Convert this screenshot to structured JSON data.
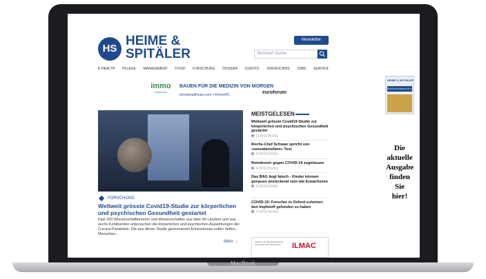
{
  "site": {
    "logo_mark": "HS",
    "logo_line1": "HEIME &",
    "logo_line2": "SPITÄLER",
    "newsletter_label": "Newsletter",
    "search_placeholder": "Stichwort Suche",
    "nav": [
      "E-HEALTH",
      "PFLEGE",
      "MANAGEMENT",
      "FOOD",
      "FORSCHUNG",
      "DOSSIER",
      "EVENTS",
      "VERZEICHNIS",
      "JOBS",
      "SERVICE"
    ]
  },
  "banner_ad": {
    "brand": "immo",
    "brand_sub": "healthcare",
    "headline": "BAUEN FÜR DIE MEDIZIN VON MORGEN",
    "url": "immohealthcare.com | #ImmoHC",
    "partner": "euroforum"
  },
  "main_article": {
    "category": "FORSCHUNG",
    "title": "Weltweit grösste Covid19-Studie zur körperlichen und psychischen Gesundheit gestartet",
    "excerpt": "Fast 200 Wissenschaftlerinnen und Wissenschaftler aus über 40 Ländern und aus sechs Kontinenten untersuchen die körperlichen und psychischen Auswirkungen der Corona-Pandemie. Die aus dieser Studie gewonnenen Erkenntnisse sollen helfen, Menschen...",
    "more_label": "Mehr →"
  },
  "meistgelesen": {
    "title": "MEISTGELESEN",
    "items": [
      {
        "title": "Weltweit grösste Covid19-Studie zur körperlichen und psychischen Gesundheit gestartet",
        "category": "FORSCHUNG"
      },
      {
        "title": "Roche-Chef Schwan spricht von «sensationellem» Test",
        "category": "FORSCHUNG"
      },
      {
        "title": "Remdesivir gegen COVID-19 zugelassen",
        "category": "FORSCHUNG"
      },
      {
        "title": "Das BAG liegt falsch - Kinder können genauso ansteckend sein wie Erwachsene",
        "category": "FORSCHUNG"
      },
      {
        "title": "COVID-19: Forscher in Oxford scheinen den Impfstoff gefunden zu haben",
        "category": "FORSCHUNG"
      }
    ]
  },
  "ilmac_ad": {
    "small_text": "Plattform für das Werkzeug der Forschung und Laboratorien",
    "logo": "ILMAC"
  },
  "side_ad": {
    "mag_logo": "HEIME & SPITÄLER",
    "mag_band": "INNOVATIONSMOTOR IT",
    "text_lines": [
      "Die",
      "aktuelle",
      "Ausgabe",
      "finden",
      "Sie",
      "hier!"
    ]
  },
  "device": {
    "label": "MacBook"
  }
}
